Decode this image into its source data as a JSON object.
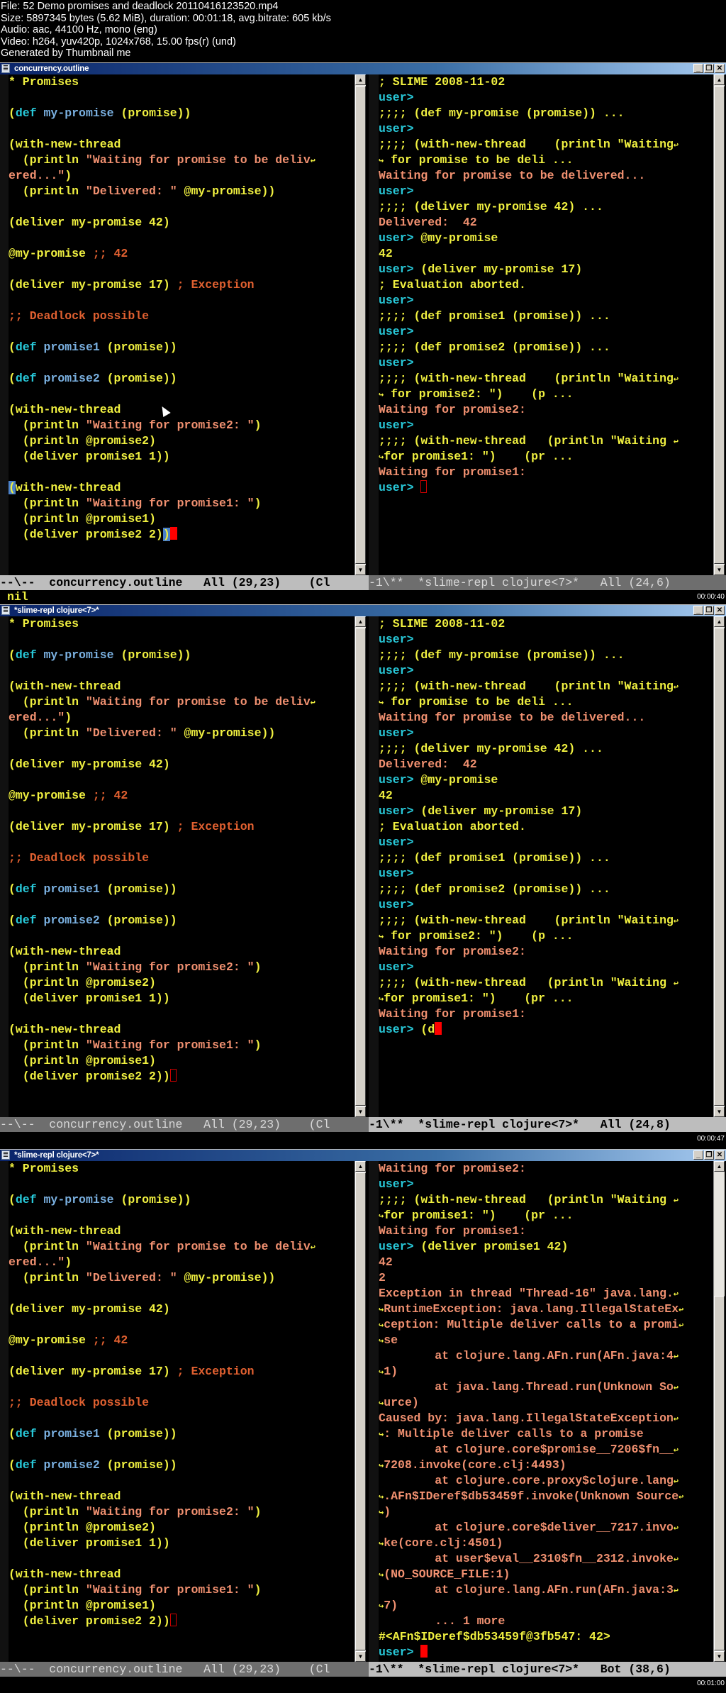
{
  "file_info": {
    "lines": [
      "File: 52 Demo promises and deadlock 20110416123520.mp4",
      "Size: 5897345 bytes (5.62 MiB), duration: 00:01:18, avg.bitrate: 605 kb/s",
      "Audio: aac, 44100 Hz, mono (eng)",
      "Video: h264, yuv420p, 1024x768, 15.00 fps(r) (und)",
      "Generated by Thumbnail me"
    ]
  },
  "colors": {
    "background": "#000000",
    "keyword": "#28c8d8",
    "function_name": "#7ab0e0",
    "code": "#f0f040",
    "string": "#f09070",
    "comment": "#e06030",
    "prompt": "#28c8d8",
    "output": "#f09070",
    "cursor": "#ff0000"
  },
  "outline_code": [
    [
      {
        "t": "* Promises",
        "c": "y"
      }
    ],
    [],
    [
      {
        "t": "(",
        "c": "y"
      },
      {
        "t": "def",
        "c": "kw"
      },
      {
        "t": " ",
        "c": "y"
      },
      {
        "t": "my-promise",
        "c": "fn"
      },
      {
        "t": " (promise))",
        "c": "y"
      }
    ],
    [],
    [
      {
        "t": "(with-new-thread",
        "c": "y"
      }
    ],
    [
      {
        "t": "  (println ",
        "c": "y"
      },
      {
        "t": "\"Waiting for promise to be deliv",
        "c": "str"
      },
      {
        "t": "↩",
        "c": "cont"
      }
    ],
    [
      {
        "t": "ered...\"",
        "c": "str"
      },
      {
        "t": ")",
        "c": "y"
      }
    ],
    [
      {
        "t": "  (println ",
        "c": "y"
      },
      {
        "t": "\"Delivered: \"",
        "c": "str"
      },
      {
        "t": " @my-promise))",
        "c": "y"
      }
    ],
    [],
    [
      {
        "t": "(deliver my-promise 42)",
        "c": "y"
      }
    ],
    [],
    [
      {
        "t": "@my-promise ",
        "c": "y"
      },
      {
        "t": ";; 42",
        "c": "cmt"
      }
    ],
    [],
    [
      {
        "t": "(deliver my-promise 17) ",
        "c": "y"
      },
      {
        "t": "; Exception",
        "c": "cmt"
      }
    ],
    [],
    [
      {
        "t": ";; Deadlock possible",
        "c": "cmt"
      }
    ],
    [],
    [
      {
        "t": "(",
        "c": "y"
      },
      {
        "t": "def",
        "c": "kw"
      },
      {
        "t": " ",
        "c": "y"
      },
      {
        "t": "promise1",
        "c": "fn"
      },
      {
        "t": " (promise))",
        "c": "y"
      }
    ],
    [],
    [
      {
        "t": "(",
        "c": "y"
      },
      {
        "t": "def",
        "c": "kw"
      },
      {
        "t": " ",
        "c": "y"
      },
      {
        "t": "promise2",
        "c": "fn"
      },
      {
        "t": " (promise))",
        "c": "y"
      }
    ],
    [],
    [
      {
        "t": "(with-new-thread",
        "c": "y"
      }
    ],
    [
      {
        "t": "  (println ",
        "c": "y"
      },
      {
        "t": "\"Waiting for promise2: \"",
        "c": "str"
      },
      {
        "t": ")",
        "c": "y"
      }
    ],
    [
      {
        "t": "  (println @promise2)",
        "c": "y"
      }
    ],
    [
      {
        "t": "  (deliver promise1 1))",
        "c": "y"
      }
    ],
    [],
    [
      {
        "t": "(with-new-thread",
        "c": "y"
      }
    ],
    [
      {
        "t": "  (println ",
        "c": "y"
      },
      {
        "t": "\"Waiting for promise1: \"",
        "c": "str"
      },
      {
        "t": ")",
        "c": "y"
      }
    ],
    [
      {
        "t": "  (println @promise1)",
        "c": "y"
      }
    ],
    [
      {
        "t": "  (deliver promise2 2))",
        "c": "y"
      }
    ]
  ],
  "panels": [
    {
      "window_title": "concurrency.outline",
      "timestamp": "00:00:40",
      "minibuffer": "nil",
      "left_modeline": "--\\--  concurrency.outline   All (29,23)    (Cl",
      "right_modeline": "-1\\**  *slime-repl clojure<7>*   All (24,6)",
      "active": "left",
      "left_cursor": "paren-highlight",
      "repl_lines": [
        [
          {
            "t": "; SLIME 2008-11-02",
            "c": "sl"
          }
        ],
        [
          {
            "t": "user>",
            "c": "prompt"
          }
        ],
        [
          {
            "t": ";;;; (def my-promise (promise)) ...",
            "c": "sl"
          }
        ],
        [
          {
            "t": "user>",
            "c": "prompt"
          }
        ],
        [
          {
            "t": ";;;; (with-new-thread    (println \"Waiting",
            "c": "sl"
          },
          {
            "t": "↩",
            "c": "cont"
          }
        ],
        [
          {
            "t": "↪",
            "c": "cont"
          },
          {
            "t": " for promise to be deli ...",
            "c": "sl"
          }
        ],
        [
          {
            "t": "Waiting for promise to be delivered...",
            "c": "out"
          }
        ],
        [
          {
            "t": "user>",
            "c": "prompt"
          }
        ],
        [
          {
            "t": ";;;; (deliver my-promise 42) ...",
            "c": "sl"
          }
        ],
        [
          {
            "t": "Delivered:  42",
            "c": "out"
          }
        ],
        [
          {
            "t": "user>",
            "c": "prompt"
          },
          {
            "t": " @my-promise",
            "c": "sl"
          }
        ],
        [
          {
            "t": "42",
            "c": "sl"
          }
        ],
        [
          {
            "t": "user>",
            "c": "prompt"
          },
          {
            "t": " (deliver my-promise 17)",
            "c": "sl"
          }
        ],
        [
          {
            "t": "; Evaluation aborted.",
            "c": "sl"
          }
        ],
        [
          {
            "t": "user>",
            "c": "prompt"
          }
        ],
        [
          {
            "t": ";;;; (def promise1 (promise)) ...",
            "c": "sl"
          }
        ],
        [
          {
            "t": "user>",
            "c": "prompt"
          }
        ],
        [
          {
            "t": ";;;; (def promise2 (promise)) ...",
            "c": "sl"
          }
        ],
        [
          {
            "t": "user>",
            "c": "prompt"
          }
        ],
        [
          {
            "t": ";;;; (with-new-thread    (println \"Waiting",
            "c": "sl"
          },
          {
            "t": "↩",
            "c": "cont"
          }
        ],
        [
          {
            "t": "↪",
            "c": "cont"
          },
          {
            "t": " for promise2: \")    (p ...",
            "c": "sl"
          }
        ],
        [
          {
            "t": "Waiting for promise2:",
            "c": "out"
          }
        ],
        [
          {
            "t": "user>",
            "c": "prompt"
          }
        ],
        [
          {
            "t": ";;;; (with-new-thread   (println \"Waiting ",
            "c": "sl"
          },
          {
            "t": "↩",
            "c": "cont"
          }
        ],
        [
          {
            "t": "↪",
            "c": "cont"
          },
          {
            "t": "for promise1: \")    (pr ...",
            "c": "sl"
          }
        ],
        [
          {
            "t": "Waiting for promise1:",
            "c": "out"
          }
        ],
        [
          {
            "t": "user> ",
            "c": "prompt"
          },
          {
            "t": "",
            "c": "curbox"
          }
        ]
      ]
    },
    {
      "window_title": "*slime-repl clojure<7>*",
      "timestamp": "00:00:47",
      "minibuffer": "",
      "left_modeline": "--\\--  concurrency.outline   All (29,23)    (Cl",
      "right_modeline": "-1\\**  *slime-repl clojure<7>*   All (24,8)",
      "active": "right",
      "left_cursor": "box",
      "repl_lines": [
        [
          {
            "t": "; SLIME 2008-11-02",
            "c": "sl"
          }
        ],
        [
          {
            "t": "user>",
            "c": "prompt"
          }
        ],
        [
          {
            "t": ";;;; (def my-promise (promise)) ...",
            "c": "sl"
          }
        ],
        [
          {
            "t": "user>",
            "c": "prompt"
          }
        ],
        [
          {
            "t": ";;;; (with-new-thread    (println \"Waiting",
            "c": "sl"
          },
          {
            "t": "↩",
            "c": "cont"
          }
        ],
        [
          {
            "t": "↪",
            "c": "cont"
          },
          {
            "t": " for promise to be deli ...",
            "c": "sl"
          }
        ],
        [
          {
            "t": "Waiting for promise to be delivered...",
            "c": "out"
          }
        ],
        [
          {
            "t": "user>",
            "c": "prompt"
          }
        ],
        [
          {
            "t": ";;;; (deliver my-promise 42) ...",
            "c": "sl"
          }
        ],
        [
          {
            "t": "Delivered:  42",
            "c": "out"
          }
        ],
        [
          {
            "t": "user>",
            "c": "prompt"
          },
          {
            "t": " @my-promise",
            "c": "sl"
          }
        ],
        [
          {
            "t": "42",
            "c": "sl"
          }
        ],
        [
          {
            "t": "user>",
            "c": "prompt"
          },
          {
            "t": " (deliver my-promise 17)",
            "c": "sl"
          }
        ],
        [
          {
            "t": "; Evaluation aborted.",
            "c": "sl"
          }
        ],
        [
          {
            "t": "user>",
            "c": "prompt"
          }
        ],
        [
          {
            "t": ";;;; (def promise1 (promise)) ...",
            "c": "sl"
          }
        ],
        [
          {
            "t": "user>",
            "c": "prompt"
          }
        ],
        [
          {
            "t": ";;;; (def promise2 (promise)) ...",
            "c": "sl"
          }
        ],
        [
          {
            "t": "user>",
            "c": "prompt"
          }
        ],
        [
          {
            "t": ";;;; (with-new-thread    (println \"Waiting",
            "c": "sl"
          },
          {
            "t": "↩",
            "c": "cont"
          }
        ],
        [
          {
            "t": "↪",
            "c": "cont"
          },
          {
            "t": " for promise2: \")    (p ...",
            "c": "sl"
          }
        ],
        [
          {
            "t": "Waiting for promise2:",
            "c": "out"
          }
        ],
        [
          {
            "t": "user>",
            "c": "prompt"
          }
        ],
        [
          {
            "t": ";;;; (with-new-thread   (println \"Waiting ",
            "c": "sl"
          },
          {
            "t": "↩",
            "c": "cont"
          }
        ],
        [
          {
            "t": "↪",
            "c": "cont"
          },
          {
            "t": "for promise1: \")    (pr ...",
            "c": "sl"
          }
        ],
        [
          {
            "t": "Waiting for promise1:",
            "c": "out"
          }
        ],
        [
          {
            "t": "user> ",
            "c": "prompt"
          },
          {
            "t": "(d",
            "c": "sl"
          },
          {
            "t": "",
            "c": "cur"
          }
        ]
      ]
    },
    {
      "window_title": "*slime-repl clojure<7>*",
      "timestamp": "00:01:00",
      "minibuffer": "",
      "left_modeline": "--\\--  concurrency.outline   All (29,23)    (Cl",
      "right_modeline": "-1\\**  *slime-repl clojure<7>*   Bot (38,6)",
      "active": "right",
      "left_cursor": "box",
      "repl_lines": [
        [
          {
            "t": "Waiting for promise2:",
            "c": "out"
          }
        ],
        [
          {
            "t": "user>",
            "c": "prompt"
          }
        ],
        [
          {
            "t": ";;;; (with-new-thread   (println \"Waiting ",
            "c": "sl"
          },
          {
            "t": "↩",
            "c": "cont"
          }
        ],
        [
          {
            "t": "↪",
            "c": "cont"
          },
          {
            "t": "for promise1: \")    (pr ...",
            "c": "sl"
          }
        ],
        [
          {
            "t": "Waiting for promise1:",
            "c": "out"
          }
        ],
        [
          {
            "t": "user>",
            "c": "prompt"
          },
          {
            "t": " (deliver promise1 42)",
            "c": "sl"
          }
        ],
        [
          {
            "t": "42",
            "c": "out"
          }
        ],
        [
          {
            "t": "2",
            "c": "out"
          }
        ],
        [
          {
            "t": "Exception in thread \"Thread-16\" java.lang.",
            "c": "out"
          },
          {
            "t": "↩",
            "c": "cont"
          }
        ],
        [
          {
            "t": "↪",
            "c": "cont"
          },
          {
            "t": "RuntimeException: java.lang.IllegalStateEx",
            "c": "out"
          },
          {
            "t": "↩",
            "c": "cont"
          }
        ],
        [
          {
            "t": "↪",
            "c": "cont"
          },
          {
            "t": "ception: Multiple deliver calls to a promi",
            "c": "out"
          },
          {
            "t": "↩",
            "c": "cont"
          }
        ],
        [
          {
            "t": "↪",
            "c": "cont"
          },
          {
            "t": "se",
            "c": "out"
          }
        ],
        [
          {
            "t": "        at clojure.lang.AFn.run(AFn.java:4",
            "c": "out"
          },
          {
            "t": "↩",
            "c": "cont"
          }
        ],
        [
          {
            "t": "↪",
            "c": "cont"
          },
          {
            "t": "1)",
            "c": "out"
          }
        ],
        [
          {
            "t": "        at java.lang.Thread.run(Unknown So",
            "c": "out"
          },
          {
            "t": "↩",
            "c": "cont"
          }
        ],
        [
          {
            "t": "↪",
            "c": "cont"
          },
          {
            "t": "urce)",
            "c": "out"
          }
        ],
        [
          {
            "t": "Caused by: java.lang.IllegalStateException",
            "c": "out"
          },
          {
            "t": "↩",
            "c": "cont"
          }
        ],
        [
          {
            "t": "↪",
            "c": "cont"
          },
          {
            "t": ": Multiple deliver calls to a promise",
            "c": "out"
          }
        ],
        [
          {
            "t": "        at clojure.core$promise__7206$fn__",
            "c": "out"
          },
          {
            "t": "↩",
            "c": "cont"
          }
        ],
        [
          {
            "t": "↪",
            "c": "cont"
          },
          {
            "t": "7208.invoke(core.clj:4493)",
            "c": "out"
          }
        ],
        [
          {
            "t": "        at clojure.core.proxy$clojure.lang",
            "c": "out"
          },
          {
            "t": "↩",
            "c": "cont"
          }
        ],
        [
          {
            "t": "↪",
            "c": "cont"
          },
          {
            "t": ".AFn$IDeref$db53459f.invoke(Unknown Source",
            "c": "out"
          },
          {
            "t": "↩",
            "c": "cont"
          }
        ],
        [
          {
            "t": "↪",
            "c": "cont"
          },
          {
            "t": ")",
            "c": "out"
          }
        ],
        [
          {
            "t": "        at clojure.core$deliver__7217.invo",
            "c": "out"
          },
          {
            "t": "↩",
            "c": "cont"
          }
        ],
        [
          {
            "t": "↪",
            "c": "cont"
          },
          {
            "t": "ke(core.clj:4501)",
            "c": "out"
          }
        ],
        [
          {
            "t": "        at user$eval__2310$fn__2312.invoke",
            "c": "out"
          },
          {
            "t": "↩",
            "c": "cont"
          }
        ],
        [
          {
            "t": "↪",
            "c": "cont"
          },
          {
            "t": "(NO_SOURCE_FILE:1)",
            "c": "out"
          }
        ],
        [
          {
            "t": "        at clojure.lang.AFn.run(AFn.java:3",
            "c": "out"
          },
          {
            "t": "↩",
            "c": "cont"
          }
        ],
        [
          {
            "t": "↪",
            "c": "cont"
          },
          {
            "t": "7)",
            "c": "out"
          }
        ],
        [
          {
            "t": "        ... 1 more",
            "c": "out"
          }
        ],
        [
          {
            "t": "#<AFn$IDeref$db53459f@3fb547: 42>",
            "c": "sl"
          }
        ],
        [
          {
            "t": "user> ",
            "c": "prompt"
          },
          {
            "t": "",
            "c": "cur"
          }
        ]
      ]
    }
  ],
  "window_buttons": {
    "minimize": "_",
    "restore": "❐",
    "close": "✕"
  },
  "scroll_arrows": {
    "up": "▲",
    "down": "▼"
  }
}
